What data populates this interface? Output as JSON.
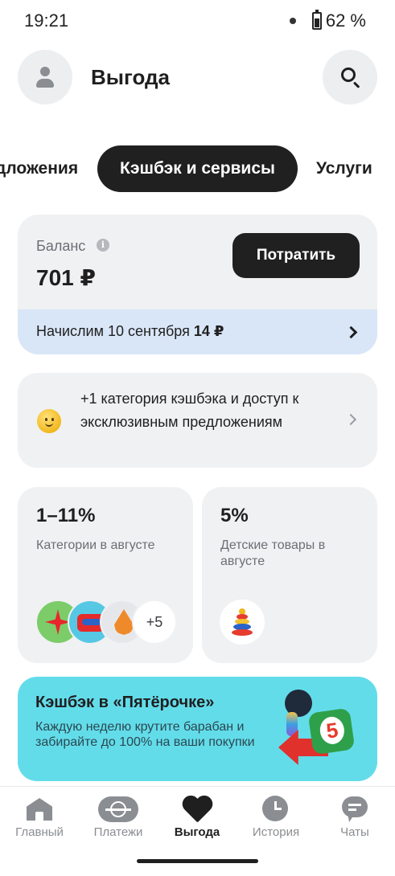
{
  "status_bar": {
    "time": "19:21",
    "battery": "62 %",
    "battery_level": 0.62
  },
  "header": {
    "title": "Выгода"
  },
  "tabs": [
    {
      "label": "дложения"
    },
    {
      "label": "Кэшбэк и сервисы",
      "active": true
    },
    {
      "label": "Услуги"
    }
  ],
  "balance": {
    "label": "Баланс",
    "info_icon": "i",
    "value": "701 ₽",
    "spend_button": "Потратить",
    "accrual_text": "Начислим 10 сентября",
    "accrual_amount": "14 ₽"
  },
  "promo": {
    "text": "+1 категория кэшбэка и доступ к эксклюзивным предложениям"
  },
  "tiles": {
    "categories": {
      "percent": "1–11%",
      "description": "Категории в августе",
      "more": "+5"
    },
    "kids": {
      "percent": "5%",
      "description": "Детские товары в августе"
    }
  },
  "banner": {
    "title": "Кэшбэк в «Пятёрочке»",
    "text": "Каждую неделю крутите барабан и забирайте до 100% на ваши покупки",
    "logo_number": "5"
  },
  "nav": {
    "items": [
      {
        "label": "Главный",
        "icon": "home-icon"
      },
      {
        "label": "Платежи",
        "icon": "payments-icon"
      },
      {
        "label": "Выгода",
        "icon": "heart-icon",
        "active": true
      },
      {
        "label": "История",
        "icon": "clock-icon"
      },
      {
        "label": "Чаты",
        "icon": "chat-icon"
      }
    ]
  },
  "colors": {
    "accent_dark": "#202020",
    "card_bg": "#f0f1f3",
    "accrual_bg": "#d9e6f7",
    "banner_bg": "#63dcea"
  }
}
